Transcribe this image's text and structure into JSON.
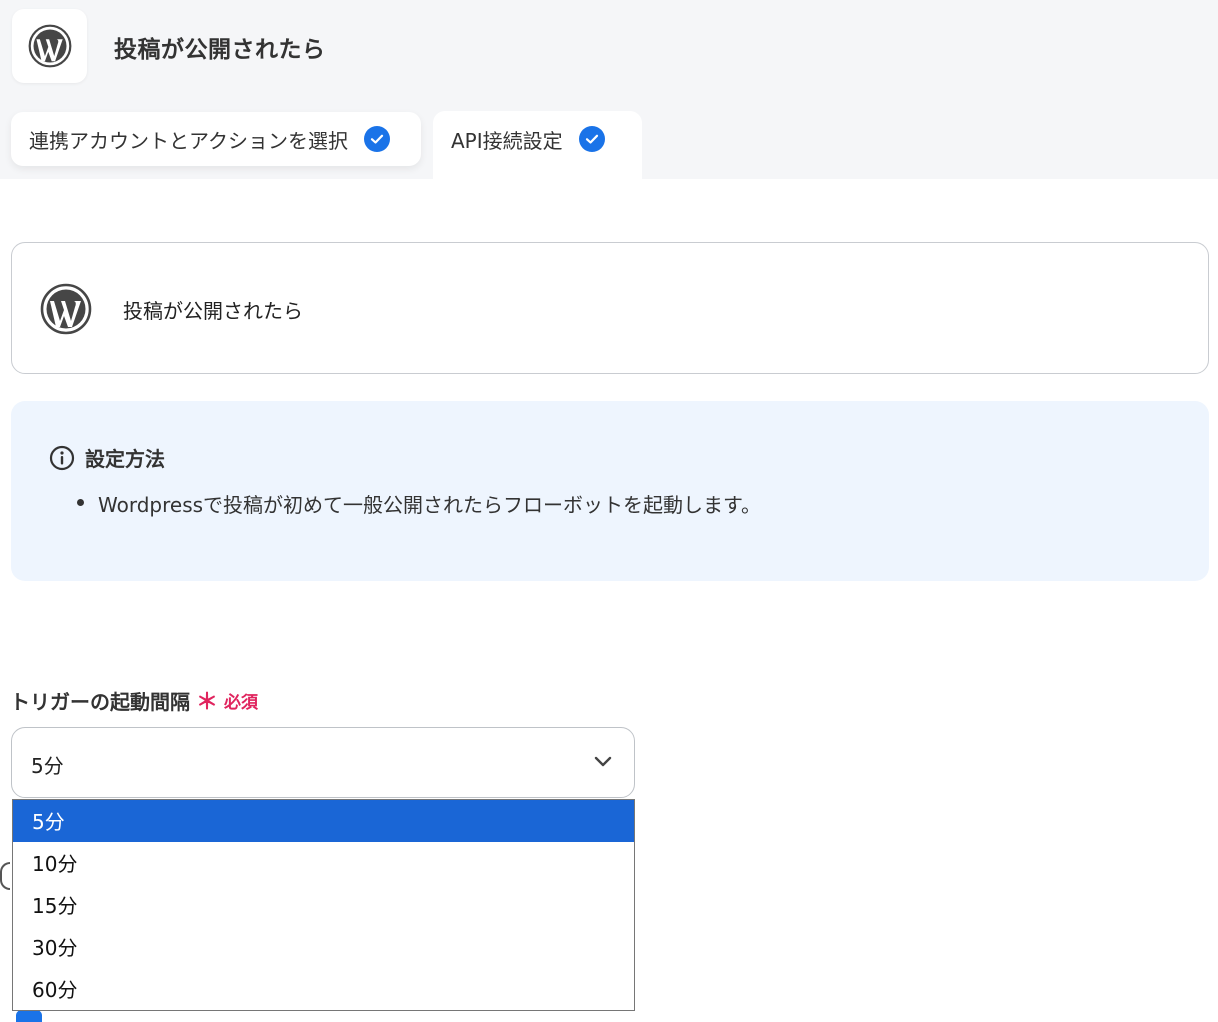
{
  "header": {
    "app_icon": "wordpress-icon",
    "title": "投稿が公開されたら"
  },
  "tabs": [
    {
      "label": "連携アカウントとアクションを選択",
      "completed": true,
      "icon": "check-circle-icon"
    },
    {
      "label": "API接続設定",
      "completed": true,
      "icon": "check-circle-icon"
    }
  ],
  "trigger_card": {
    "icon": "wordpress-icon",
    "title": "投稿が公開されたら"
  },
  "info": {
    "icon": "info-circle-icon",
    "heading": "設定方法",
    "items": [
      "Wordpressで投稿が初めて一般公開されたらフローボットを起動します。"
    ]
  },
  "interval_field": {
    "label": "トリガーの起動間隔",
    "required_mark": "＊",
    "required_text": "必須",
    "selected": "5分",
    "options": [
      "5分",
      "10分",
      "15分",
      "30分",
      "60分"
    ]
  },
  "colors": {
    "accent": "#1a73e8",
    "selected_option": "#1a66d6",
    "required": "#e0245e",
    "info_bg": "#eef5fe"
  }
}
